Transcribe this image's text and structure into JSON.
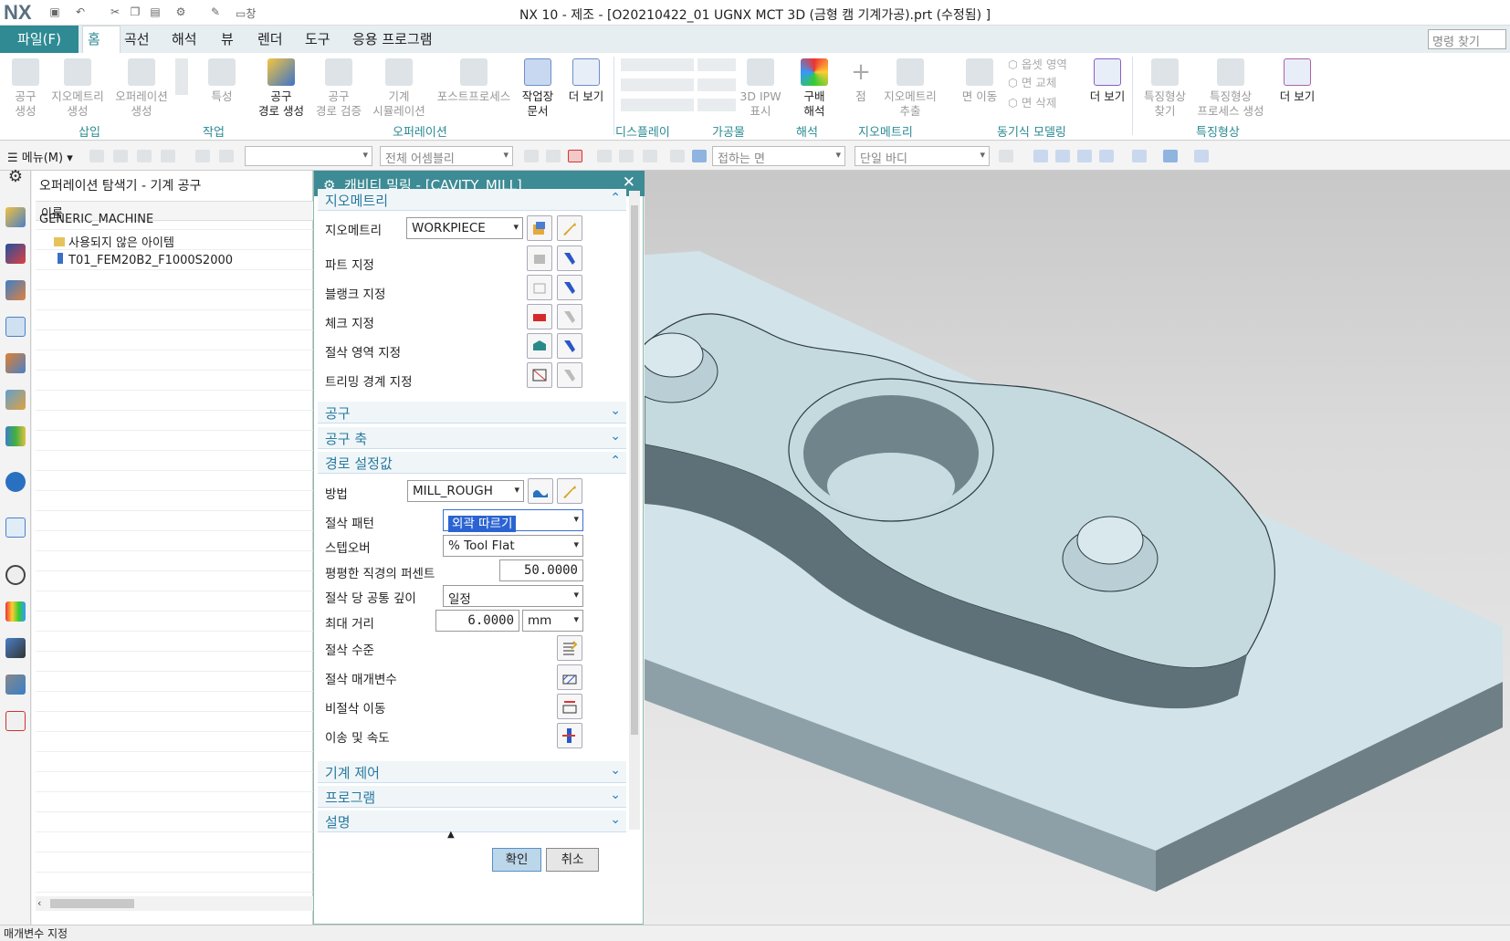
{
  "app": {
    "logo": "NX",
    "window_title": "NX 10 - 제조 - [O20210422_01 UGNX MCT 3D (금형 캠 기계가공).prt (수정됨) ]",
    "quick_access_window": "창"
  },
  "ribbon_tabs": {
    "file": "파일(F)",
    "items": [
      "홈",
      "곡선",
      "해석",
      "뷰",
      "렌더",
      "도구",
      "응용 프로그램"
    ],
    "active": "홈"
  },
  "command_search": {
    "placeholder": "명령 찾기"
  },
  "ribbon": {
    "buttons": {
      "tool_create": "공구\n생성",
      "geometry_create": "지오메트리\n생성",
      "operation_create": "오퍼레이션\n생성",
      "property": "특성",
      "tool_path_create": "공구\n경로 생성",
      "tool_path_verify": "공구\n경로 검증",
      "machine_sim": "기계\n시뮬레이션",
      "postprocess": "포스트프로세스",
      "shop_doc": "작업장\n문서",
      "more1": "더 보기",
      "ipw_show": "3D IPW\n표시",
      "gouge": "구배\n해석",
      "point": "점",
      "geom_extract": "지오메트리\n추출",
      "face_move": "면 이동",
      "offset_region": "옵셋 영역",
      "face_replace": "면 교체",
      "face_delete": "면 삭제",
      "more2": "더 보기",
      "feature_find": "특징형상\n찾기",
      "feature_process": "특징형상\n프로세스 생성",
      "more3": "더 보기"
    },
    "groups": [
      "삽입",
      "작업",
      "오퍼레이션",
      "디스플레이",
      "가공물",
      "해석",
      "지오메트리",
      "동기식 모델링",
      "특징형상"
    ]
  },
  "toolbar2": {
    "menu": "메뉴(M)",
    "filter_assembly": "전체 어셈블리",
    "snap_face": "접하는 면",
    "body": "단일 바디",
    "empty_combo": ""
  },
  "navigator": {
    "title": "오퍼레이션 탐색기 - 기계 공구",
    "column": "이름",
    "rows": [
      "GENERIC_MACHINE",
      "사용되지 않은 아이템",
      "T01_FEM20B2_F1000S2000"
    ]
  },
  "dialog": {
    "title": "캐비티 밀링 - [CAVITY_MILL]",
    "sections": {
      "geometry": "지오메트리",
      "tool": "공구",
      "tool_axis": "공구 축",
      "path_settings": "경로 설정값",
      "machine_control": "기계 제어",
      "program": "프로그램",
      "description": "설명"
    },
    "geometry": {
      "label": "지오메트리",
      "value": "WORKPIECE",
      "part": "파트 지정",
      "blank": "블랭크 지정",
      "check": "체크 지정",
      "cut_area": "절삭 영역 지정",
      "trim": "트리밍 경계 지정"
    },
    "path": {
      "method_label": "방법",
      "method_value": "MILL_ROUGH",
      "pattern_label": "절삭 패턴",
      "pattern_value": "외곽 따르기",
      "stepover_label": "스텝오버",
      "stepover_value": "% Tool Flat",
      "percent_label": "평평한 직경의 퍼센트",
      "percent_value": "50.0000",
      "depth_label": "절삭 당 공통 깊이",
      "depth_value": "일정",
      "max_label": "최대 거리",
      "max_value": "6.0000",
      "max_unit": "mm",
      "levels": "절삭 수준",
      "params": "절삭 매개변수",
      "noncut": "비절삭 이동",
      "feeds": "이송 및 속도"
    },
    "ok": "확인",
    "cancel": "취소"
  },
  "status": {
    "text": "매개변수 지정"
  },
  "colors": {
    "accent": "#2f8a93",
    "dialog_header": "#3d8b95",
    "part_face": "#c8dde3"
  }
}
